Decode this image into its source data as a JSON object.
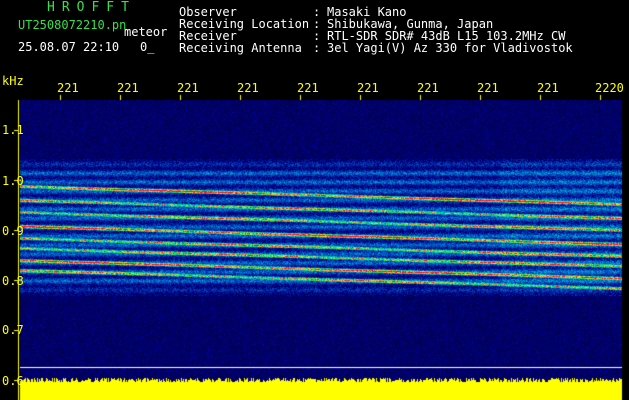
{
  "header": {
    "brand": "HROFFT",
    "filename": "UT2508072210.pn",
    "meteor_label": "meteor",
    "date_time": "25.08.07 22:10",
    "count": "0_"
  },
  "station": [
    {
      "key": "Observer",
      "sep": ":",
      "value": "Masaki Kano"
    },
    {
      "key": "Receiving Location",
      "sep": ":",
      "value": "Shibukawa, Gunma, Japan"
    },
    {
      "key": "Receiver",
      "sep": ":",
      "value": "RTL-SDR SDR# 43dB L15 103.2MHz CW"
    },
    {
      "key": "Receiving Antenna",
      "sep": ":",
      "value": "3el Yagi(V) Az 330 for Vladivostok"
    }
  ],
  "axis": {
    "y_unit": "kHz",
    "y_ticks": [
      "1.1",
      "1.0",
      "0.9",
      "0.8",
      "0.7",
      "0.6"
    ],
    "x_ticks": [
      "221",
      "221",
      "221",
      "221",
      "221",
      "221",
      "221",
      "221",
      "221",
      "2220"
    ]
  },
  "colors": {
    "label": "#39e04a",
    "info": "#ffffff",
    "axis": "#ffff00",
    "background": "#000000",
    "noise_floor": "#0a0f7a"
  }
}
